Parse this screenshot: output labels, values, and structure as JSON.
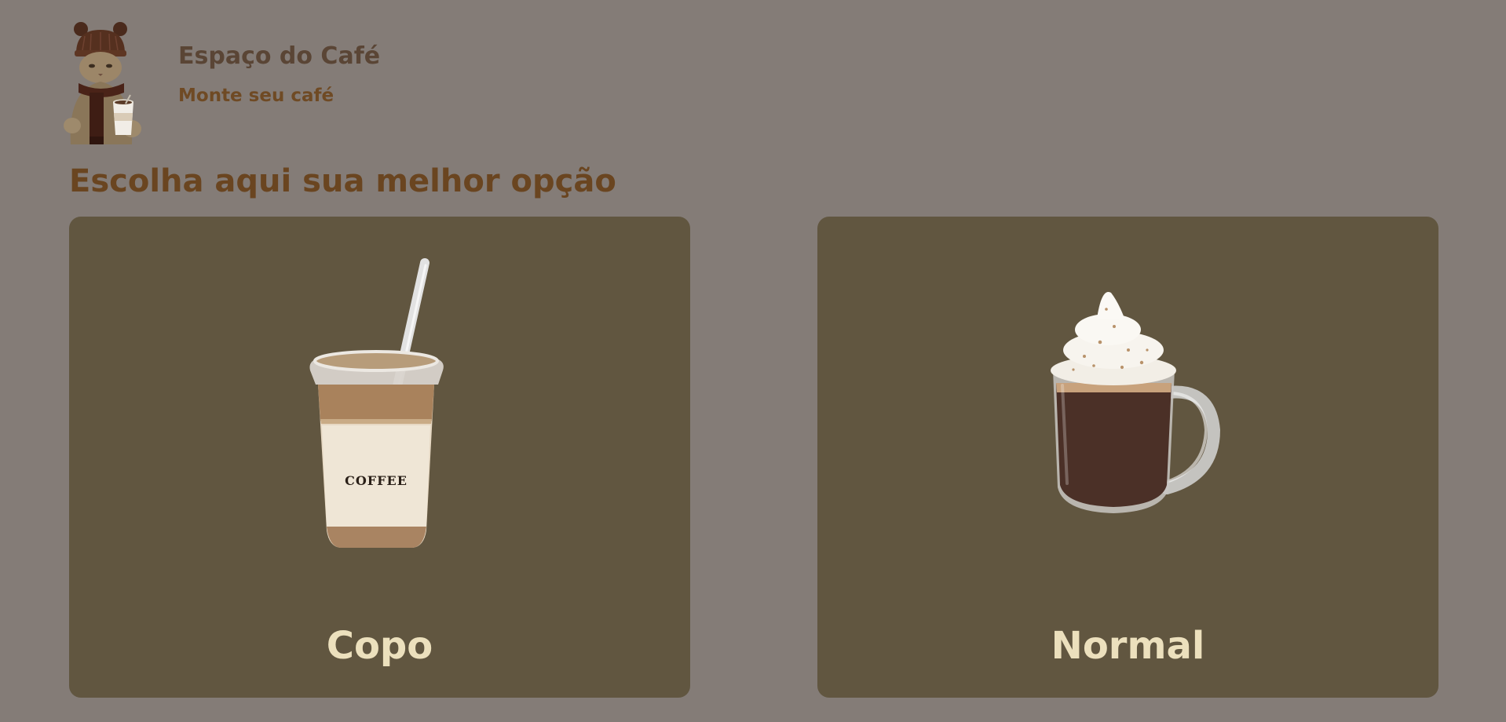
{
  "header": {
    "title": "Espaço do Café",
    "subtitle": "Monte seu café"
  },
  "main": {
    "section_title": "Escolha aqui sua melhor opção",
    "options": [
      {
        "label": "Copo",
        "cup_print": "COFFEE"
      },
      {
        "label": "Normal"
      }
    ]
  },
  "colors": {
    "page_background": "#847c77",
    "card_background": "#615640",
    "card_label": "#ece0bd",
    "title": "#5a4535",
    "accent_brown": "#6a4520"
  },
  "icons": {
    "logo": "cat-with-coffee-logo",
    "option_copo": "iced-coffee-cup-icon",
    "option_normal": "hot-chocolate-mug-icon"
  }
}
